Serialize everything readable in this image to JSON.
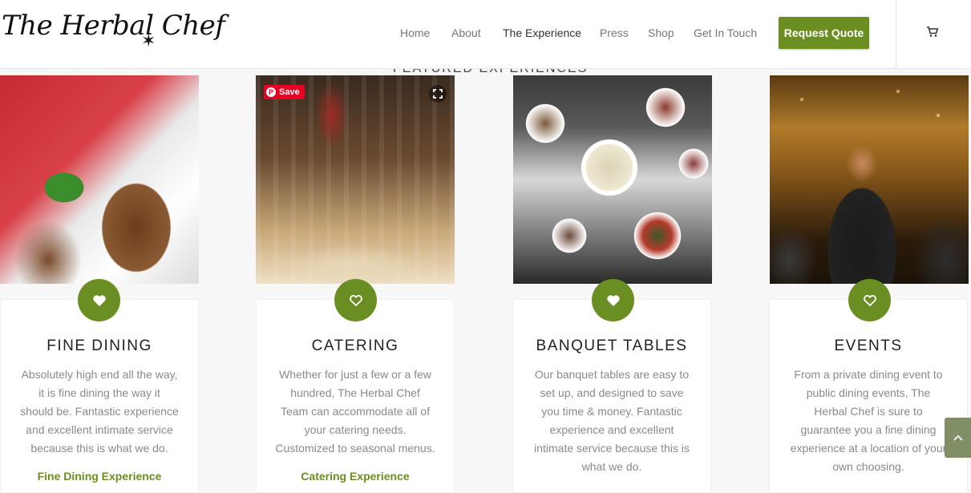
{
  "header": {
    "logo_text": "The Herbal Chef",
    "nav": [
      {
        "label": "Home"
      },
      {
        "label": "About"
      },
      {
        "label": "The Experience"
      },
      {
        "label": "Press"
      },
      {
        "label": "Shop"
      },
      {
        "label": "Get In Touch"
      }
    ],
    "quote_button": "Request Quote",
    "cart_icon": "cart-icon"
  },
  "section": {
    "heading": "FEATURED EXPERIENCES"
  },
  "pinterest": {
    "save_label": "Save"
  },
  "cards": [
    {
      "title": "FINE DINING",
      "desc": [
        "Absolutely high end all the way,",
        "it is fine dining the way it",
        "should be. Fantastic experience",
        "and excellent intimate service",
        "because this is what we do."
      ],
      "link": "Fine Dining Experience",
      "heart_style": "filled"
    },
    {
      "title": "CATERING",
      "desc": [
        "Whether for just a few or a few",
        "hundred, The Herbal Chef",
        "Team can accommodate all of",
        "your catering needs.",
        "Customized to seasonal menus."
      ],
      "link": "Catering Experience",
      "heart_style": "outline"
    },
    {
      "title": "BANQUET TABLES",
      "desc": [
        "Our banquet tables are easy to",
        "set up, and designed to save",
        "you time & money. Fantastic",
        "experience and excellent",
        "intimate service because this is",
        "what we do."
      ],
      "link": "",
      "heart_style": "filled"
    },
    {
      "title": "EVENTS",
      "desc": [
        "From a private dining event to",
        "public dining events, The",
        "Herbal Chef is sure to",
        "guarantee you a fine dining",
        "experience at a location of your",
        "own choosing."
      ],
      "link": "",
      "heart_style": "outline"
    }
  ],
  "colors": {
    "accent": "#6b8e23",
    "pinterest": "#e60023"
  }
}
